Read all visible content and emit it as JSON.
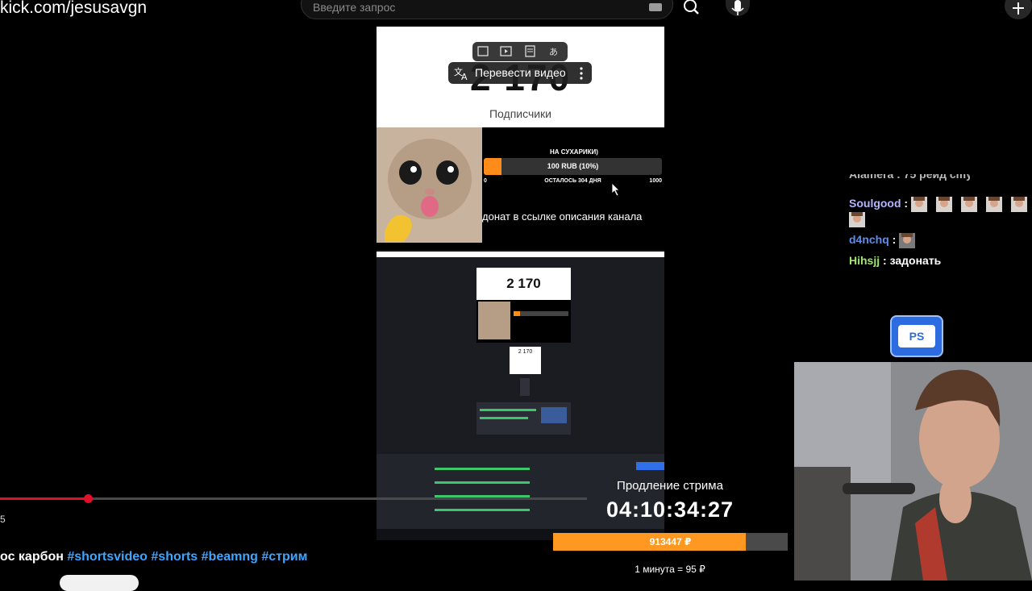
{
  "browser": {
    "url": "kick.com/jesusavgn",
    "search_placeholder": "Введите запрос"
  },
  "video": {
    "subscriber_count": "2 170",
    "subscriber_label": "Подписчики",
    "translate_button": "Перевести видео",
    "goal": {
      "title": "НА СУХАРИКИ)",
      "amount": "100 RUB (10%)",
      "progress": 0.1,
      "start": "0",
      "remaining": "ОСТАЛОСЬ 304 ДНЯ",
      "end": "1000"
    },
    "donate_text": "донат в ссылке описания канала",
    "nested_count": "2 170",
    "progress": 0.15,
    "time_fragment": "5"
  },
  "caption": {
    "text": "ос карбон",
    "tags": [
      "#shortsvideo",
      "#shorts",
      "#beamng",
      "#стрим"
    ]
  },
  "stream_overlay": {
    "extension_label": "Продление стрима",
    "timer": "04:10:34:27",
    "amount": "913447 ₽",
    "amount_progress": 0.82,
    "rate": "1 минута = 95 ₽"
  },
  "chat": {
    "cut_line": "Alamera : 75 рейд cmy",
    "messages": [
      {
        "user": "Soulgood",
        "user_color": "#b4b4ff",
        "text": "",
        "emotes": 6
      },
      {
        "user": "d4nchq",
        "user_color": "#5b8def",
        "text": "",
        "emotes": 1
      },
      {
        "user": "Hihsjj",
        "user_color": "#9fe86f",
        "text": "задонать",
        "emotes": 0
      }
    ],
    "badge": "PS"
  },
  "colors": {
    "accent_red": "#e0102a",
    "accent_orange": "#ff9820",
    "link_blue": "#3ea6ff"
  }
}
